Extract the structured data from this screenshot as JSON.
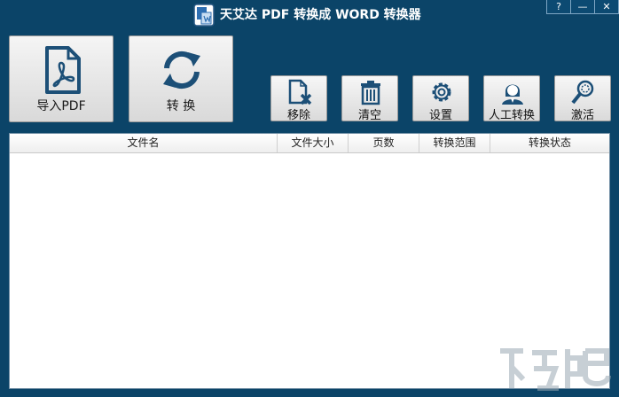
{
  "window": {
    "title": "天艾达 PDF 转换成 WORD 转换器",
    "controls": {
      "help": "?",
      "minimize": "—",
      "close": "✕"
    }
  },
  "toolbar": {
    "import_label": "导入PDF",
    "convert_label": "转 换",
    "remove_label": "移除",
    "clear_label": "清空",
    "settings_label": "设置",
    "manual_label": "人工转换",
    "activate_label": "激活"
  },
  "table": {
    "columns": [
      "文件名",
      "文件大小",
      "页数",
      "转换范围",
      "转换状态"
    ],
    "rows": []
  },
  "colors": {
    "background": "#0b4468",
    "icon_blue": "#1c4f77",
    "button_face": "#e6e6e6"
  },
  "icons": [
    "pdf-file-icon",
    "refresh-icon",
    "remove-file-icon",
    "trash-icon",
    "gear-icon",
    "person-icon",
    "magnifier-icon"
  ]
}
